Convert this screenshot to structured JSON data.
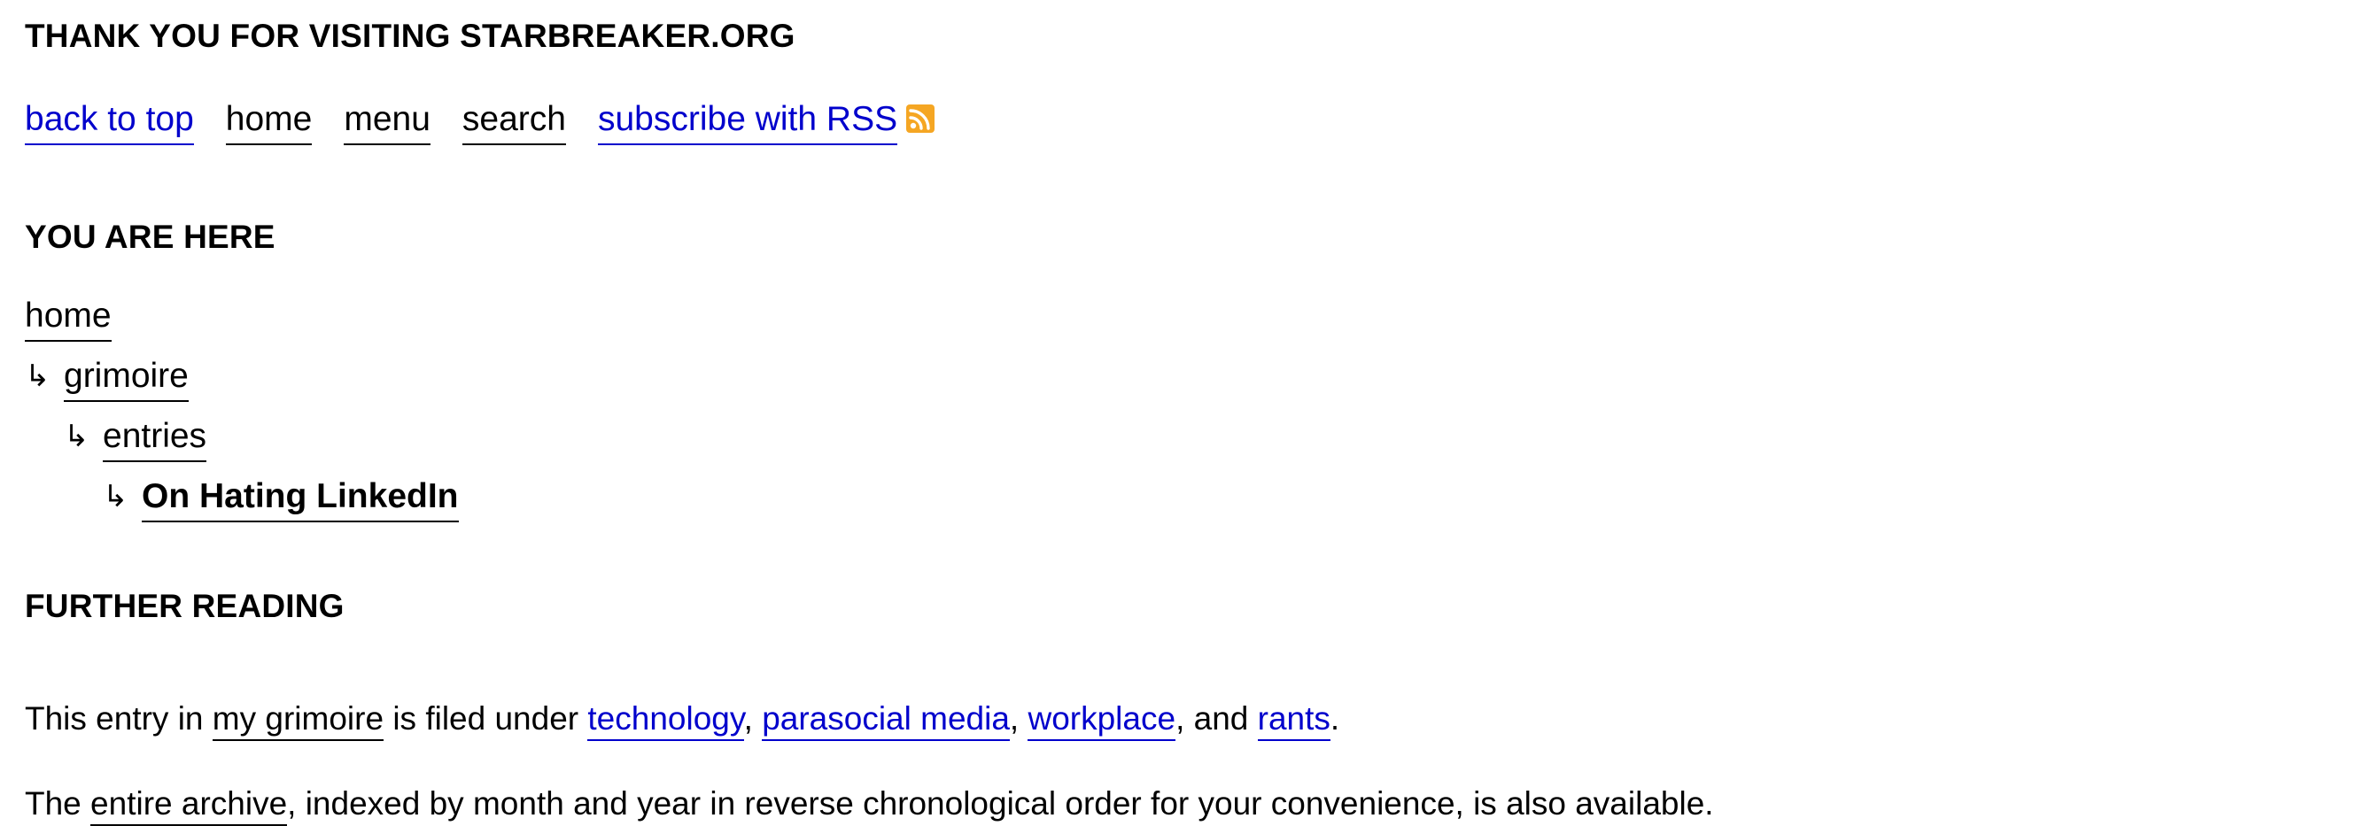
{
  "header": {
    "title": "THANK YOU FOR VISITING STARBREAKER.ORG"
  },
  "nav": {
    "back_to_top": "back to top",
    "home": "home",
    "menu": "menu",
    "search": "search",
    "subscribe": "subscribe with RSS",
    "rss_icon": "rss-icon",
    "link_color": "#0000cc",
    "rss_color": "#f5a623"
  },
  "you_are_here": {
    "title": "YOU ARE HERE",
    "crumbs": [
      {
        "label": "home"
      },
      {
        "label": "grimoire"
      },
      {
        "label": "entries"
      },
      {
        "label": "On Hating LinkedIn"
      }
    ],
    "arrow": "↳"
  },
  "further_reading": {
    "title": "FURTHER READING",
    "para1": {
      "prefix": "This entry in ",
      "grimoire_link": "my grimoire",
      "mid": " is filed under ",
      "tags": [
        "technology",
        "parasocial media",
        "workplace",
        "rants"
      ],
      "sep1": ", ",
      "sep2": ", ",
      "sep3": ", and ",
      "end": "."
    },
    "para2": {
      "prefix": "The ",
      "archive_link": "entire archive",
      "suffix": ", indexed by month and year in reverse chronological order for your convenience, is also available."
    }
  }
}
